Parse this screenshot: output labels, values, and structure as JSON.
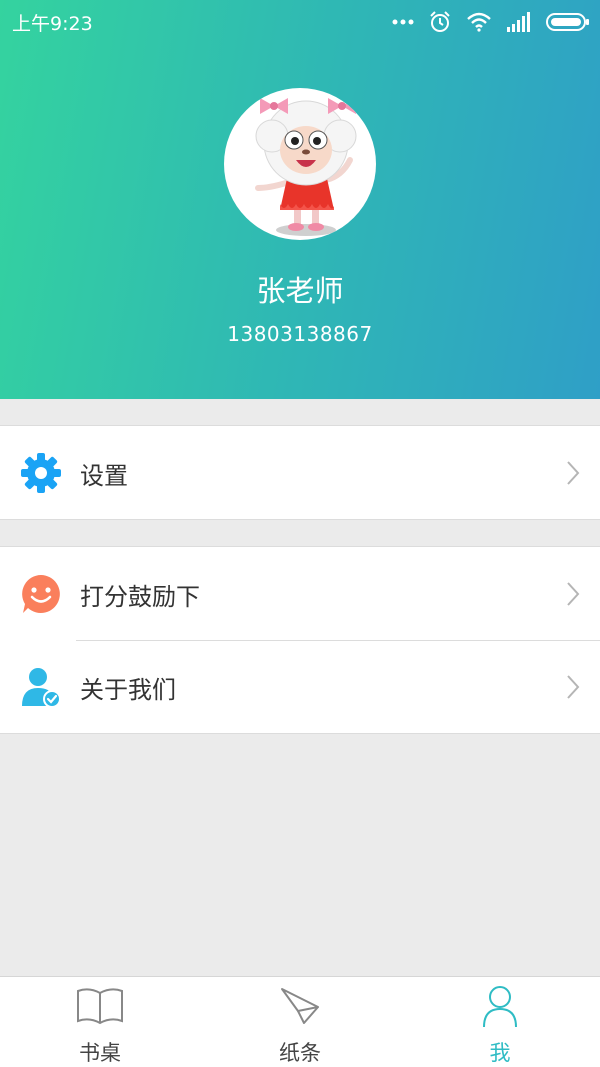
{
  "status_bar": {
    "time": "上午9:23"
  },
  "profile": {
    "name": "张老师",
    "phone": "13803138867"
  },
  "menu": {
    "settings_label": "设置",
    "rate_label": "打分鼓励下",
    "about_label": "关于我们"
  },
  "tabbar": {
    "tabs": [
      {
        "label": "书桌",
        "icon": "book-icon"
      },
      {
        "label": "纸条",
        "icon": "paper-plane-icon"
      },
      {
        "label": "我",
        "icon": "person-icon"
      }
    ],
    "active_index": 2
  },
  "colors": {
    "header_gradient_start": "#34d39f",
    "header_gradient_end": "#2f9fc7",
    "active_tab": "#2fbcc4",
    "settings_icon": "#1aa3f5",
    "rate_icon": "#fa7f5c",
    "about_icon": "#2fb8e6"
  }
}
